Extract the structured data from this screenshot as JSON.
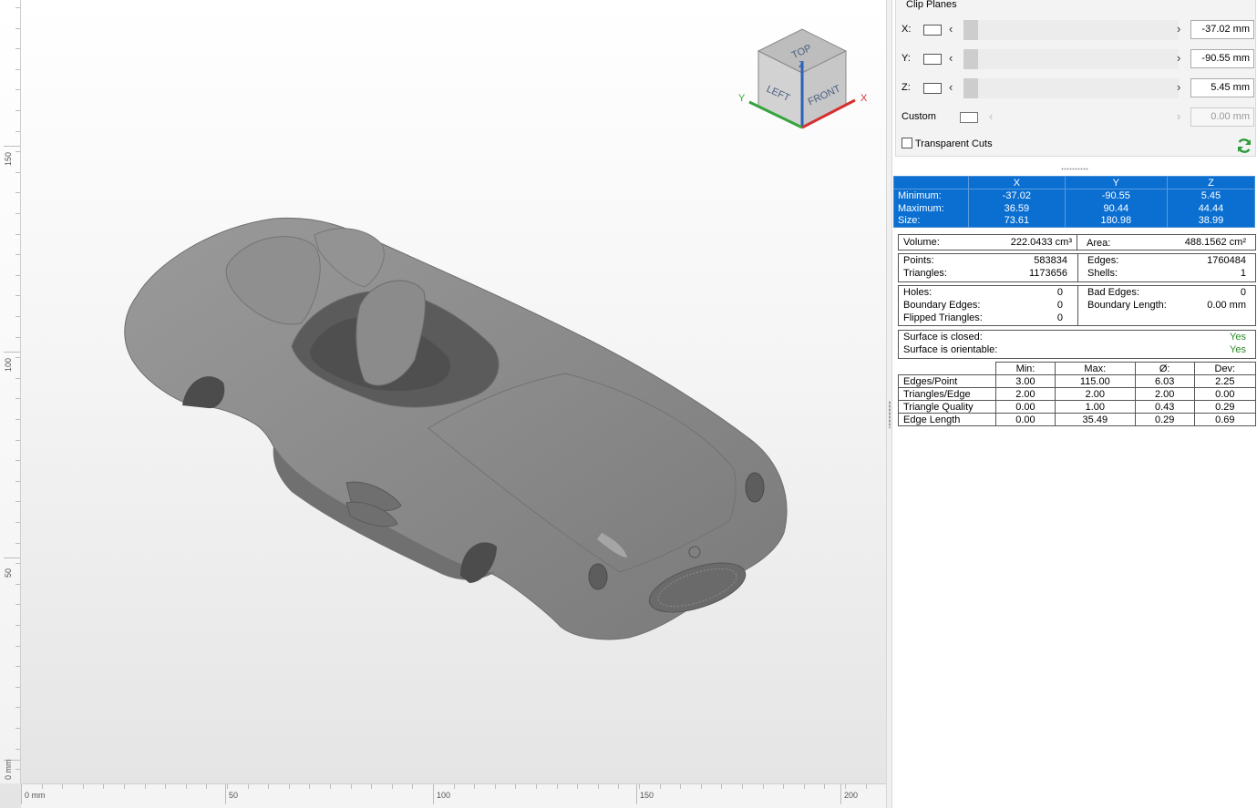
{
  "rulers": {
    "vertical": [
      "150",
      "100",
      "50",
      "0 mm"
    ],
    "horizontal": [
      "0 mm",
      "50",
      "100",
      "150",
      "200"
    ]
  },
  "viewcube": {
    "top": "TOP",
    "left": "LEFT",
    "front": "FRONT",
    "axis_x": "X",
    "axis_y": "Y",
    "axis_z": "Z"
  },
  "clip_planes": {
    "title": "Clip Planes",
    "rows": [
      {
        "label": "X:",
        "value": "-37.02 mm"
      },
      {
        "label": "Y:",
        "value": "-90.55 mm"
      },
      {
        "label": "Z:",
        "value": "5.45 mm"
      },
      {
        "label": "Custom",
        "value": "0.00 mm"
      }
    ],
    "transparent_cuts": "Transparent Cuts"
  },
  "bounding_box": {
    "headers": [
      "X",
      "Y",
      "Z"
    ],
    "rows": [
      {
        "label": "Minimum:",
        "values": [
          "-37.02",
          "-90.55",
          "5.45"
        ]
      },
      {
        "label": "Maximum:",
        "values": [
          "36.59",
          "90.44",
          "44.44"
        ]
      },
      {
        "label": "Size:",
        "values": [
          "73.61",
          "180.98",
          "38.99"
        ]
      }
    ]
  },
  "volume": {
    "label": "Volume:",
    "value": "222.0433 cm³"
  },
  "area": {
    "label": "Area:",
    "value": "488.1562 cm²"
  },
  "points": {
    "label": "Points:",
    "value": "583834"
  },
  "triangles": {
    "label": "Triangles:",
    "value": "1173656"
  },
  "edges": {
    "label": "Edges:",
    "value": "1760484"
  },
  "shells": {
    "label": "Shells:",
    "value": "1"
  },
  "holes": {
    "label": "Holes:",
    "value": "0"
  },
  "boundary_edges": {
    "label": "Boundary Edges:",
    "value": "0"
  },
  "flipped_triangles": {
    "label": "Flipped Triangles:",
    "value": "0"
  },
  "bad_edges": {
    "label": "Bad Edges:",
    "value": "0"
  },
  "boundary_length": {
    "label": "Boundary Length:",
    "value": "0.00 mm"
  },
  "surface_closed": {
    "label": "Surface is closed:",
    "value": "Yes"
  },
  "surface_orientable": {
    "label": "Surface is orientable:",
    "value": "Yes"
  },
  "stats": {
    "headers": [
      "Min:",
      "Max:",
      "Ø:",
      "Dev:"
    ],
    "rows": [
      {
        "label": "Edges/Point",
        "values": [
          "3.00",
          "115.00",
          "6.03",
          "2.25"
        ]
      },
      {
        "label": "Triangles/Edge",
        "values": [
          "2.00",
          "2.00",
          "2.00",
          "0.00"
        ]
      },
      {
        "label": "Triangle Quality",
        "values": [
          "0.00",
          "1.00",
          "0.43",
          "0.29"
        ]
      },
      {
        "label": "Edge Length",
        "values": [
          "0.00",
          "35.49",
          "0.29",
          "0.69"
        ]
      }
    ]
  }
}
